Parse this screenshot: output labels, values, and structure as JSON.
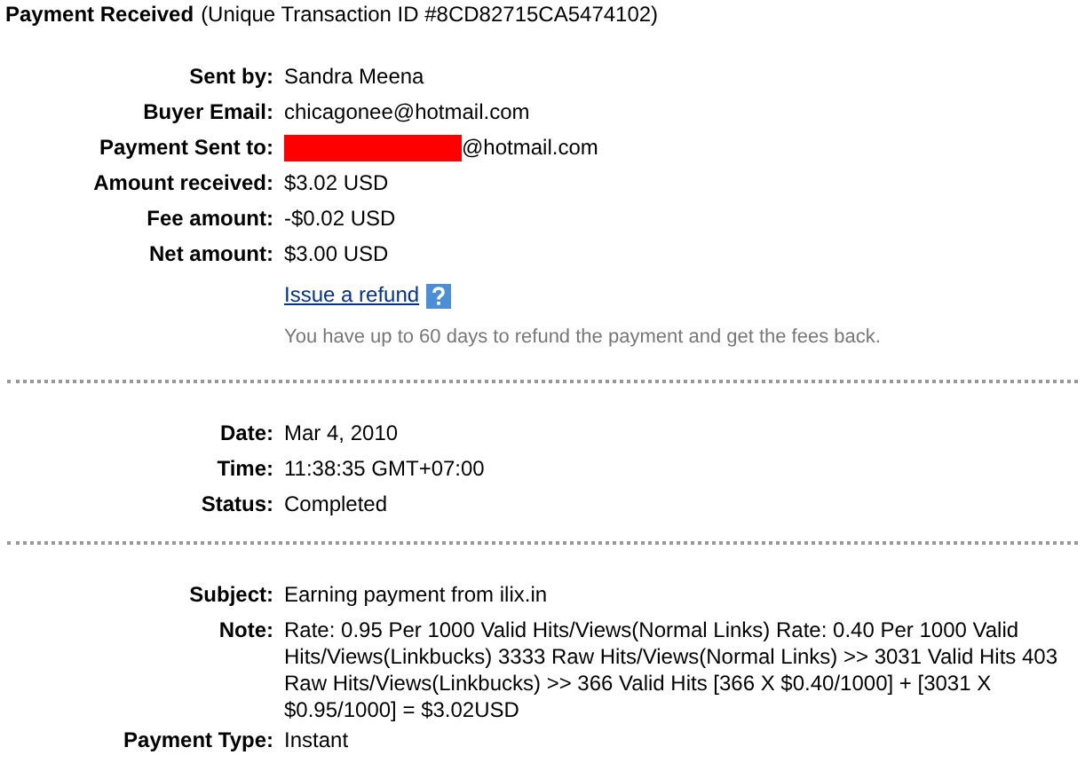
{
  "header": {
    "title": "Payment Received",
    "transaction": "(Unique Transaction ID #8CD82715CA5474102)"
  },
  "sections": [
    {
      "rows": [
        {
          "kind": "text",
          "label": "Sent by:",
          "value": "Sandra Meena"
        },
        {
          "kind": "text",
          "label": "Buyer Email:",
          "value": "chicagonee@hotmail.com"
        },
        {
          "kind": "redacted",
          "label": "Payment Sent to:",
          "value": "@hotmail.com"
        },
        {
          "kind": "text",
          "label": "Amount received:",
          "value": "$3.02 USD"
        },
        {
          "kind": "text",
          "label": "Fee amount:",
          "value": "-$0.02 USD"
        },
        {
          "kind": "text",
          "label": "Net amount:",
          "value": "$3.00 USD"
        },
        {
          "kind": "refund",
          "link": "Issue a refund",
          "note": "You have up to 60 days to refund the payment and get the fees back."
        }
      ]
    },
    {
      "rows": [
        {
          "kind": "text",
          "label": "Date:",
          "value": "Mar 4, 2010"
        },
        {
          "kind": "text",
          "label": "Time:",
          "value": "11:38:35 GMT+07:00"
        },
        {
          "kind": "text",
          "label": "Status:",
          "value": "Completed"
        }
      ]
    },
    {
      "rows": [
        {
          "kind": "text",
          "label": "Subject:",
          "value": "Earning payment from ilix.in"
        },
        {
          "kind": "text",
          "label": "Note:",
          "value": "Rate: 0.95 Per 1000 Valid Hits/Views(Normal Links) Rate: 0.40 Per 1000 Valid Hits/Views(Linkbucks) 3333 Raw Hits/Views(Normal Links) >> 3031 Valid Hits 403 Raw Hits/Views(Linkbucks) >> 366 Valid Hits [366 X $0.40/1000] + [3031 X $0.95/1000] = $3.02USD"
        },
        {
          "kind": "text",
          "label": "Payment Type:",
          "value": "Instant"
        }
      ]
    }
  ]
}
